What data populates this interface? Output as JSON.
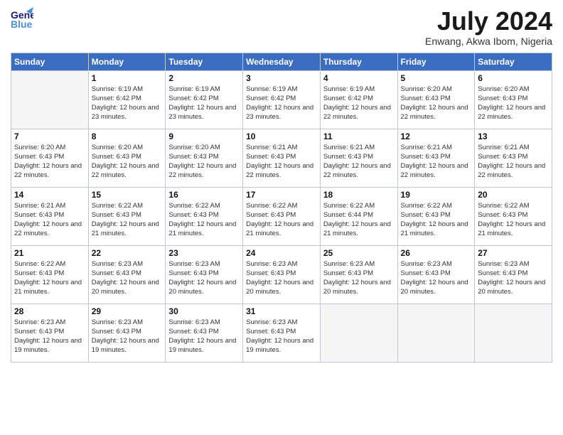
{
  "header": {
    "logo_line1": "General",
    "logo_line2": "Blue",
    "month": "July 2024",
    "location": "Enwang, Akwa Ibom, Nigeria"
  },
  "weekdays": [
    "Sunday",
    "Monday",
    "Tuesday",
    "Wednesday",
    "Thursday",
    "Friday",
    "Saturday"
  ],
  "weeks": [
    [
      {
        "day": "",
        "sunrise": "",
        "sunset": "",
        "daylight": ""
      },
      {
        "day": "1",
        "sunrise": "Sunrise: 6:19 AM",
        "sunset": "Sunset: 6:42 PM",
        "daylight": "Daylight: 12 hours and 23 minutes."
      },
      {
        "day": "2",
        "sunrise": "Sunrise: 6:19 AM",
        "sunset": "Sunset: 6:42 PM",
        "daylight": "Daylight: 12 hours and 23 minutes."
      },
      {
        "day": "3",
        "sunrise": "Sunrise: 6:19 AM",
        "sunset": "Sunset: 6:42 PM",
        "daylight": "Daylight: 12 hours and 23 minutes."
      },
      {
        "day": "4",
        "sunrise": "Sunrise: 6:19 AM",
        "sunset": "Sunset: 6:42 PM",
        "daylight": "Daylight: 12 hours and 22 minutes."
      },
      {
        "day": "5",
        "sunrise": "Sunrise: 6:20 AM",
        "sunset": "Sunset: 6:43 PM",
        "daylight": "Daylight: 12 hours and 22 minutes."
      },
      {
        "day": "6",
        "sunrise": "Sunrise: 6:20 AM",
        "sunset": "Sunset: 6:43 PM",
        "daylight": "Daylight: 12 hours and 22 minutes."
      }
    ],
    [
      {
        "day": "7",
        "sunrise": "Sunrise: 6:20 AM",
        "sunset": "Sunset: 6:43 PM",
        "daylight": "Daylight: 12 hours and 22 minutes."
      },
      {
        "day": "8",
        "sunrise": "Sunrise: 6:20 AM",
        "sunset": "Sunset: 6:43 PM",
        "daylight": "Daylight: 12 hours and 22 minutes."
      },
      {
        "day": "9",
        "sunrise": "Sunrise: 6:20 AM",
        "sunset": "Sunset: 6:43 PM",
        "daylight": "Daylight: 12 hours and 22 minutes."
      },
      {
        "day": "10",
        "sunrise": "Sunrise: 6:21 AM",
        "sunset": "Sunset: 6:43 PM",
        "daylight": "Daylight: 12 hours and 22 minutes."
      },
      {
        "day": "11",
        "sunrise": "Sunrise: 6:21 AM",
        "sunset": "Sunset: 6:43 PM",
        "daylight": "Daylight: 12 hours and 22 minutes."
      },
      {
        "day": "12",
        "sunrise": "Sunrise: 6:21 AM",
        "sunset": "Sunset: 6:43 PM",
        "daylight": "Daylight: 12 hours and 22 minutes."
      },
      {
        "day": "13",
        "sunrise": "Sunrise: 6:21 AM",
        "sunset": "Sunset: 6:43 PM",
        "daylight": "Daylight: 12 hours and 22 minutes."
      }
    ],
    [
      {
        "day": "14",
        "sunrise": "Sunrise: 6:21 AM",
        "sunset": "Sunset: 6:43 PM",
        "daylight": "Daylight: 12 hours and 22 minutes."
      },
      {
        "day": "15",
        "sunrise": "Sunrise: 6:22 AM",
        "sunset": "Sunset: 6:43 PM",
        "daylight": "Daylight: 12 hours and 21 minutes."
      },
      {
        "day": "16",
        "sunrise": "Sunrise: 6:22 AM",
        "sunset": "Sunset: 6:43 PM",
        "daylight": "Daylight: 12 hours and 21 minutes."
      },
      {
        "day": "17",
        "sunrise": "Sunrise: 6:22 AM",
        "sunset": "Sunset: 6:43 PM",
        "daylight": "Daylight: 12 hours and 21 minutes."
      },
      {
        "day": "18",
        "sunrise": "Sunrise: 6:22 AM",
        "sunset": "Sunset: 6:44 PM",
        "daylight": "Daylight: 12 hours and 21 minutes."
      },
      {
        "day": "19",
        "sunrise": "Sunrise: 6:22 AM",
        "sunset": "Sunset: 6:43 PM",
        "daylight": "Daylight: 12 hours and 21 minutes."
      },
      {
        "day": "20",
        "sunrise": "Sunrise: 6:22 AM",
        "sunset": "Sunset: 6:43 PM",
        "daylight": "Daylight: 12 hours and 21 minutes."
      }
    ],
    [
      {
        "day": "21",
        "sunrise": "Sunrise: 6:22 AM",
        "sunset": "Sunset: 6:43 PM",
        "daylight": "Daylight: 12 hours and 21 minutes."
      },
      {
        "day": "22",
        "sunrise": "Sunrise: 6:23 AM",
        "sunset": "Sunset: 6:43 PM",
        "daylight": "Daylight: 12 hours and 20 minutes."
      },
      {
        "day": "23",
        "sunrise": "Sunrise: 6:23 AM",
        "sunset": "Sunset: 6:43 PM",
        "daylight": "Daylight: 12 hours and 20 minutes."
      },
      {
        "day": "24",
        "sunrise": "Sunrise: 6:23 AM",
        "sunset": "Sunset: 6:43 PM",
        "daylight": "Daylight: 12 hours and 20 minutes."
      },
      {
        "day": "25",
        "sunrise": "Sunrise: 6:23 AM",
        "sunset": "Sunset: 6:43 PM",
        "daylight": "Daylight: 12 hours and 20 minutes."
      },
      {
        "day": "26",
        "sunrise": "Sunrise: 6:23 AM",
        "sunset": "Sunset: 6:43 PM",
        "daylight": "Daylight: 12 hours and 20 minutes."
      },
      {
        "day": "27",
        "sunrise": "Sunrise: 6:23 AM",
        "sunset": "Sunset: 6:43 PM",
        "daylight": "Daylight: 12 hours and 20 minutes."
      }
    ],
    [
      {
        "day": "28",
        "sunrise": "Sunrise: 6:23 AM",
        "sunset": "Sunset: 6:43 PM",
        "daylight": "Daylight: 12 hours and 19 minutes."
      },
      {
        "day": "29",
        "sunrise": "Sunrise: 6:23 AM",
        "sunset": "Sunset: 6:43 PM",
        "daylight": "Daylight: 12 hours and 19 minutes."
      },
      {
        "day": "30",
        "sunrise": "Sunrise: 6:23 AM",
        "sunset": "Sunset: 6:43 PM",
        "daylight": "Daylight: 12 hours and 19 minutes."
      },
      {
        "day": "31",
        "sunrise": "Sunrise: 6:23 AM",
        "sunset": "Sunset: 6:43 PM",
        "daylight": "Daylight: 12 hours and 19 minutes."
      },
      {
        "day": "",
        "sunrise": "",
        "sunset": "",
        "daylight": ""
      },
      {
        "day": "",
        "sunrise": "",
        "sunset": "",
        "daylight": ""
      },
      {
        "day": "",
        "sunrise": "",
        "sunset": "",
        "daylight": ""
      }
    ]
  ]
}
